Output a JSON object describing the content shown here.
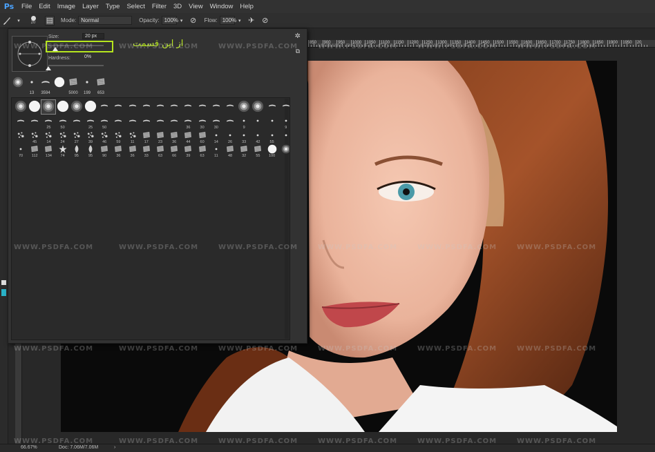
{
  "menubar": {
    "logo": "Ps",
    "items": [
      "File",
      "Edit",
      "Image",
      "Layer",
      "Type",
      "Select",
      "Filter",
      "3D",
      "View",
      "Window",
      "Help"
    ]
  },
  "options": {
    "brush_size": "20",
    "mode_label": "Mode:",
    "mode_value": "Normal",
    "opacity_label": "Opacity:",
    "opacity_value": "100%",
    "flow_label": "Flow:",
    "flow_value": "100%"
  },
  "ruler": {
    "labels": [
      "850",
      "900",
      "950",
      "1000",
      "1050",
      "1100",
      "1150",
      "1200",
      "1250",
      "1300",
      "1350",
      "1400",
      "1450",
      "1500",
      "1550",
      "1600",
      "1650",
      "1700",
      "1750",
      "1800",
      "1850",
      "1900",
      "1950",
      "20"
    ]
  },
  "brush_panel": {
    "size_label": "Size:",
    "size_value": "20 px",
    "size_level": 0.08,
    "hardness_label": "Hardness:",
    "hardness_value": "0%",
    "hardness_level": 0.0,
    "annotation": "از این قسمت",
    "recent_numbers": [
      "",
      "13",
      "3594",
      "",
      "5000",
      "199",
      "653"
    ],
    "grid_numbers": [
      [
        "",
        "",
        "",
        "",
        "",
        "",
        "",
        "",
        "",
        "",
        "",
        "",
        "",
        "",
        "",
        "",
        "",
        "",
        "",
        ""
      ],
      [
        "",
        "",
        "25",
        "50",
        "",
        "25",
        "50",
        "",
        "",
        "",
        "",
        "",
        "36",
        "30",
        "30",
        "",
        "9",
        "",
        "",
        "9"
      ],
      [
        "",
        "45",
        "14",
        "24",
        "27",
        "39",
        "46",
        "59",
        "11",
        "17",
        "23",
        "36",
        "44",
        "60",
        "14",
        "26",
        "33",
        "42",
        "55",
        ""
      ],
      [
        "70",
        "112",
        "134",
        "74",
        "95",
        "95",
        "90",
        "36",
        "36",
        "33",
        "63",
        "66",
        "39",
        "63",
        "11",
        "48",
        "32",
        "55",
        "100",
        ""
      ]
    ]
  },
  "watermark": "WWW.PSDFA.COM",
  "status": {
    "zoom": "66.67%",
    "doc": "Doc: 7.06M/7.06M"
  }
}
